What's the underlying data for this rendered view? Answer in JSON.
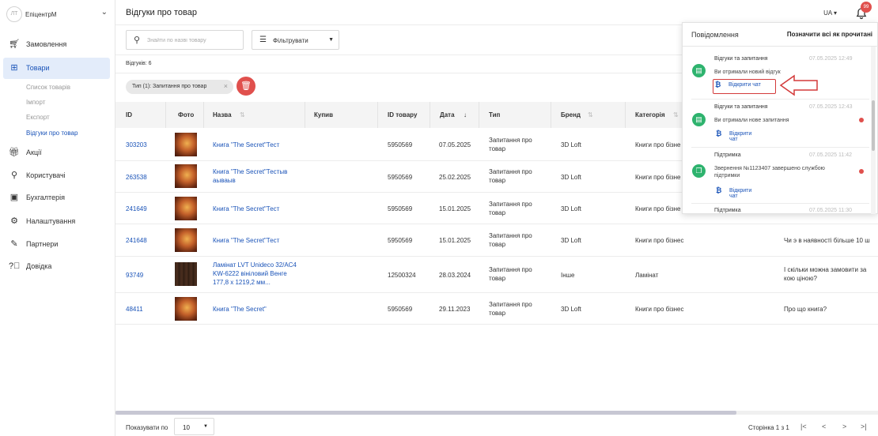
{
  "sidebar": {
    "avatar_text": "ЛТ",
    "company": "ЕпіцентрМ",
    "items": [
      {
        "label": "Замовлення",
        "icon": "cart-icon"
      },
      {
        "label": "Товари",
        "icon": "box-icon"
      },
      {
        "label": "Акції",
        "icon": "gift-icon"
      },
      {
        "label": "Користувачі",
        "icon": "users-icon"
      },
      {
        "label": "Бухгалтерія",
        "icon": "wallet-icon"
      },
      {
        "label": "Налаштування",
        "icon": "gear-icon"
      },
      {
        "label": "Партнери",
        "icon": "handshake-icon"
      },
      {
        "label": "Довідка",
        "icon": "help-icon"
      }
    ],
    "subitems": [
      "Список товарів",
      "Імпорт",
      "Експорт",
      "Відгуки про товар"
    ]
  },
  "header": {
    "title": "Відгуки про товар",
    "lang": "UA",
    "badge": "99"
  },
  "toolbar": {
    "search_placeholder": "Знайти по назві товару",
    "filter_label": "Фільтрувати"
  },
  "reviews_count": "Відгуків: 6",
  "chip": {
    "label": "Тип (1): Запитання про товар"
  },
  "table": {
    "columns": [
      "ID",
      "Фото",
      "Назва",
      "Купив",
      "ID товару",
      "Дата",
      "Тип",
      "Бренд",
      "Категорія"
    ],
    "rows": [
      {
        "id": "303203",
        "name": "Книга \"The Secret\"Тест",
        "product_id": "5950569",
        "date": "07.05.2025",
        "type": "Запитання про товар",
        "brand": "3D Loft",
        "category": "Книги про бізне",
        "text": ""
      },
      {
        "id": "263538",
        "name": "Книга \"The Secret\"Тестываываыв",
        "product_id": "5950569",
        "date": "25.02.2025",
        "type": "Запитання про товар",
        "brand": "3D Loft",
        "category": "Книги про бізне",
        "text": ""
      },
      {
        "id": "241649",
        "name": "Книга \"The Secret\"Тест",
        "product_id": "5950569",
        "date": "15.01.2025",
        "type": "Запитання про товар",
        "brand": "3D Loft",
        "category": "Книги про бізне",
        "text": ""
      },
      {
        "id": "241648",
        "name": "Книга \"The Secret\"Тест",
        "product_id": "5950569",
        "date": "15.01.2025",
        "type": "Запитання про товар",
        "brand": "3D Loft",
        "category": "Книги про бізнес",
        "text": "Чи э в наявності більше 10 ш"
      },
      {
        "id": "93749",
        "name": "Ламінат LVT Unideco 32/АС4 KW-6222 вініловий Венге 177,8 х 1219,2 мм...",
        "product_id": "12500324",
        "date": "28.03.2024",
        "type": "Запитання про товар",
        "brand": "Інше",
        "category": "Ламінат",
        "text": "І скільки можна замовити за кою ціною?"
      },
      {
        "id": "48411",
        "name": "Книга \"The Secret\"",
        "product_id": "5950569",
        "date": "29.11.2023",
        "type": "Запитання про товар",
        "brand": "3D Loft",
        "category": "Книги про бізнес",
        "text": "Про що книга?"
      }
    ]
  },
  "footer": {
    "per_page_label": "Показувати по",
    "per_page": "10",
    "page_info": "Сторінка 1 з 1"
  },
  "notifications": {
    "title": "Повідомлення",
    "mark_all": "Позначити всі як прочитані",
    "items": [
      {
        "title": "Відгуки та запитання",
        "time": "07.05.2025 12:49",
        "text": "Ви отримали новий відгук",
        "button": "Відкрити чат"
      },
      {
        "title": "Відгуки та запитання",
        "time": "07.05.2025 12:43",
        "text": "Ви отримали нове запитання",
        "button": "Відкрити чат"
      },
      {
        "title": "Підтримка",
        "time": "07.05.2025 11:42",
        "text": "Звернення №1123407 завершено службою підтримки",
        "button": "Відкрити чат"
      },
      {
        "title": "Підтримка",
        "time": "07.05.2025 11:30"
      }
    ]
  }
}
